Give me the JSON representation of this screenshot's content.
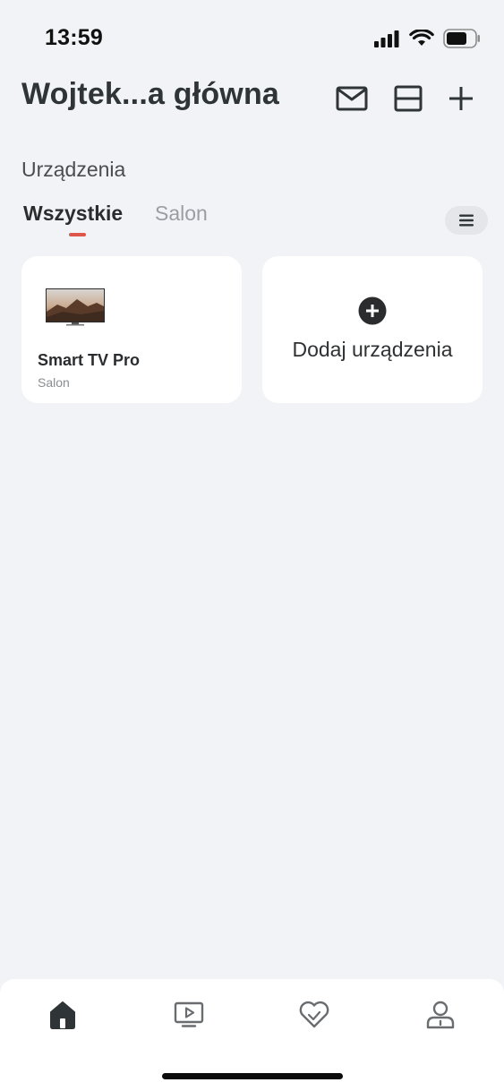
{
  "status_bar": {
    "time": "13:59",
    "icons": [
      "signal-icon",
      "wifi-icon",
      "battery-icon"
    ]
  },
  "header": {
    "title": "Wojtek...a główna",
    "actions": [
      "mail-icon",
      "layout-icon",
      "add-icon"
    ]
  },
  "devices_section": {
    "title": "Urządzenia",
    "tabs": [
      {
        "label": "Wszystkie",
        "selected": true
      },
      {
        "label": "Salon",
        "selected": false
      }
    ],
    "accent_color": "#e0554a"
  },
  "cards": {
    "device": {
      "name": "Smart TV Pro",
      "room": "Salon"
    },
    "add": {
      "label": "Dodaj urządzenia"
    }
  },
  "bottom_nav": {
    "items": [
      "home-icon",
      "media-icon",
      "favorites-icon",
      "profile-icon"
    ],
    "selected": "home-icon"
  }
}
